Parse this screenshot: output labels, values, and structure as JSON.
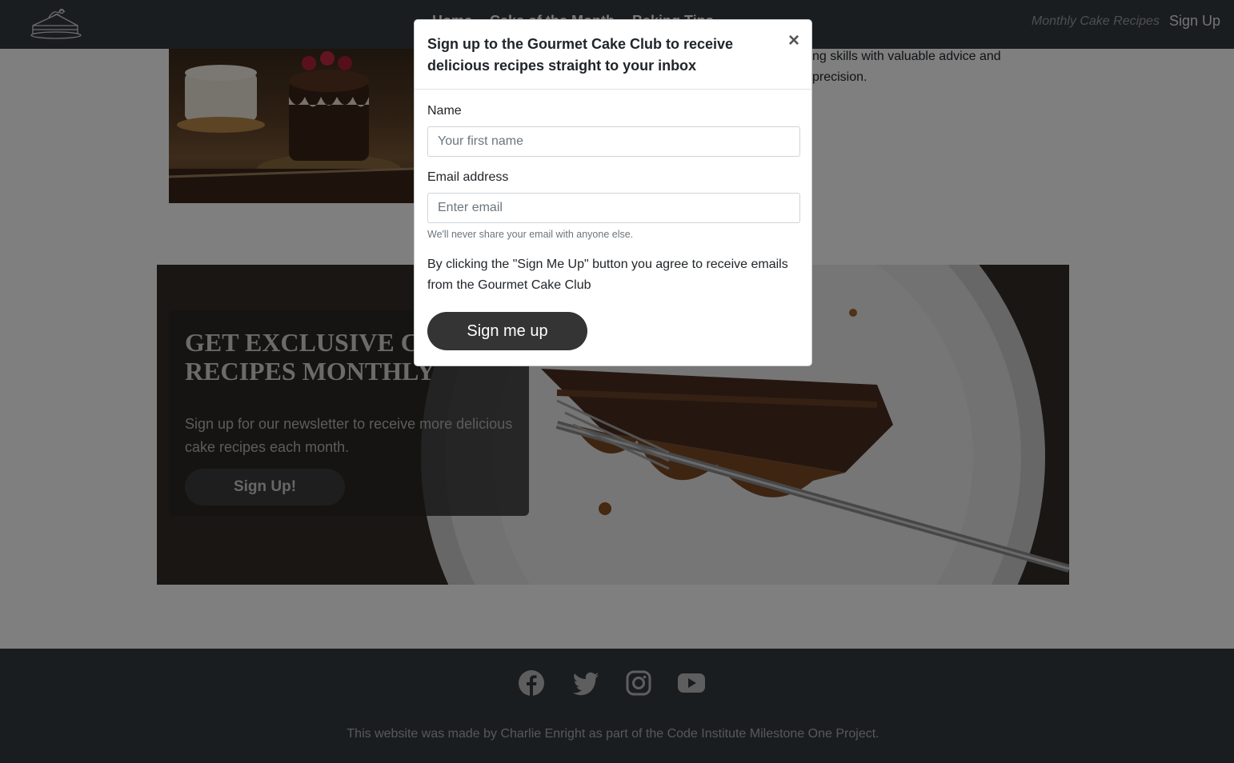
{
  "navbar": {
    "links": [
      "Home",
      "Cake of the Month",
      "Baking Tips"
    ],
    "recipes_link": "Monthly Cake Recipes",
    "signup_link": "Sign Up"
  },
  "intro": {
    "text_partial": "ng skills with valuable advice and precision."
  },
  "hero": {
    "title": "GET EXCLUSIVE CAKE\nRECIPES MONTHLY",
    "text": "Sign up for our newsletter to receive more delicious cake recipes each month.",
    "button": "Sign Up!"
  },
  "footer": {
    "social_icons": [
      "facebook-icon",
      "twitter-icon",
      "instagram-icon",
      "youtube-icon"
    ],
    "credit": "This website was made by Charlie Enright as part of the Code Institute Milestone One Project."
  },
  "modal": {
    "title": "Sign up to the Gourmet Cake Club to receive delicious recipes straight to your inbox",
    "close": "×",
    "name_label": "Name",
    "name_placeholder": "Your first name",
    "email_label": "Email address",
    "email_placeholder": "Enter email",
    "email_help": "We'll never share your email with anyone else.",
    "agreement": "By clicking the \"Sign Me Up\" button you agree to receive emails from the Gourmet Cake Club",
    "submit": "Sign me up"
  },
  "colors": {
    "navbar_bg": "#343a40",
    "footer_bg": "#343a40",
    "button_dark": "#343434",
    "backdrop": "rgba(0,0,0,0.5)"
  }
}
